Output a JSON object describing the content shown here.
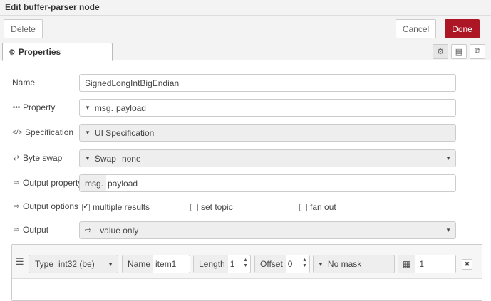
{
  "dialog": {
    "title": "Edit buffer-parser node"
  },
  "toolbar": {
    "delete_label": "Delete",
    "cancel_label": "Cancel",
    "done_label": "Done"
  },
  "tabs": {
    "properties_label": "Properties",
    "icons": [
      "gear-icon",
      "description-icon",
      "appearance-icon"
    ]
  },
  "form": {
    "name": {
      "label": "Name",
      "value": "SignedLongIntBigEndian"
    },
    "property": {
      "label": "Property",
      "prefix": "msg.",
      "value": "payload"
    },
    "specification": {
      "label": "Specification",
      "value": "UI Specification"
    },
    "byte_swap": {
      "label": "Byte swap",
      "value": "Swap",
      "extra": "none"
    },
    "output_property": {
      "label": "Output property",
      "prefix": "msg.",
      "value": "payload"
    },
    "output_options": {
      "label": "Output options",
      "multiple_results": {
        "label": "multiple results",
        "checked": true
      },
      "set_topic": {
        "label": "set topic",
        "checked": false
      },
      "fan_out": {
        "label": "fan out",
        "checked": false
      }
    },
    "output": {
      "label": "Output",
      "value": "value only"
    }
  },
  "items": [
    {
      "type_label": "Type",
      "type_value": "int32 (be)",
      "name_label": "Name",
      "name_value": "item1",
      "length_label": "Length",
      "length_value": "1",
      "offset_label": "Offset",
      "offset_value": "0",
      "mask_value": "No mask",
      "scale_value": "1"
    }
  ]
}
